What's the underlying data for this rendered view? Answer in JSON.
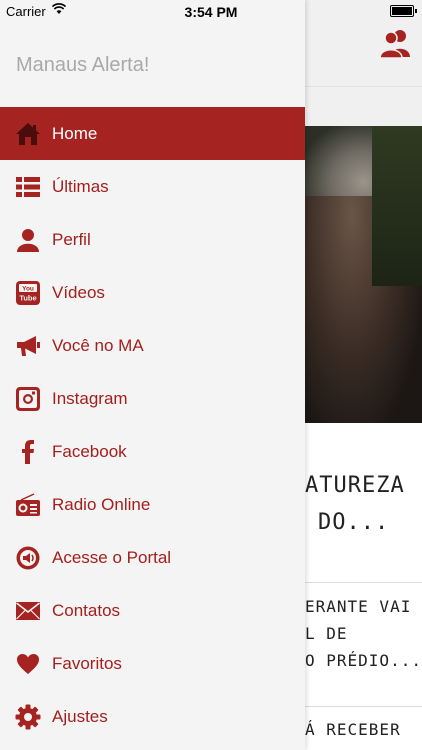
{
  "status_bar": {
    "carrier": "Carrier",
    "time": "3:54 PM"
  },
  "drawer": {
    "app_title": "Manaus Alerta!",
    "items": [
      {
        "label": "Home",
        "icon": "home-icon",
        "active": true
      },
      {
        "label": "Últimas",
        "icon": "list-icon"
      },
      {
        "label": "Perfil",
        "icon": "user-icon"
      },
      {
        "label": "Vídeos",
        "icon": "youtube-icon"
      },
      {
        "label": "Você no MA",
        "icon": "megaphone-icon"
      },
      {
        "label": "Instagram",
        "icon": "instagram-icon"
      },
      {
        "label": "Facebook",
        "icon": "facebook-icon"
      },
      {
        "label": "Radio Online",
        "icon": "radio-icon"
      },
      {
        "label": "Acesse o Portal",
        "icon": "portal-icon"
      },
      {
        "label": "Contatos",
        "icon": "mail-icon"
      },
      {
        "label": "Favoritos",
        "icon": "heart-icon"
      },
      {
        "label": "Ajustes",
        "icon": "gear-icon"
      }
    ]
  },
  "background": {
    "headline_line1": "ATUREZA",
    "headline_line2": "DO...",
    "article2_line1": "ERANTE VAI",
    "article2_line2": "L DE",
    "article2_line3": "O PRÉDIO...",
    "article3_line1": "Á RECEBER"
  },
  "colors": {
    "accent": "#a52421",
    "title_gray": "#a9a9a9",
    "drawer_bg": "#f4f4f4"
  }
}
